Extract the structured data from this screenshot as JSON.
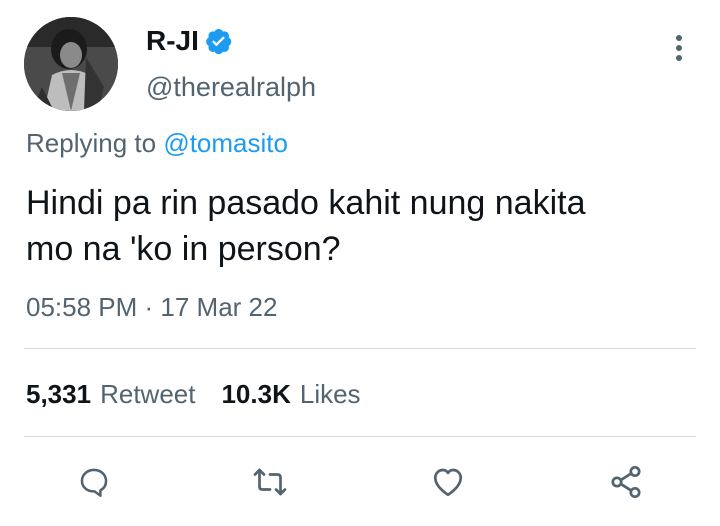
{
  "tweet": {
    "display_name": "R-JI",
    "handle": "@therealralph",
    "replying_prefix": "Replying to",
    "replying_handle": "@tomasito",
    "text_line1": "Hindi pa rin pasado kahit nung nakita",
    "text_line2": "mo na 'ko in person?",
    "timestamp": "05:58 PM · 17 Mar 22"
  },
  "stats": {
    "retweets_count": "5,331",
    "retweets_label": "Retweet",
    "likes_count": "10.3K",
    "likes_label": "Likes"
  },
  "icons": {
    "verified": "verified-badge-icon",
    "more": "more-vertical-icon",
    "reply": "reply-icon",
    "retweet": "retweet-icon",
    "like": "heart-icon",
    "share": "share-icon"
  },
  "colors": {
    "accent": "#1d9bf0",
    "secondary_text": "#536471",
    "primary_text": "#0f1419",
    "divider": "#d9dde1"
  }
}
